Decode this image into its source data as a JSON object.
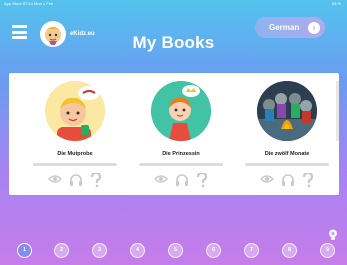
{
  "statusbar": {
    "left": "App Store  07:14  Mon 1 Feb",
    "right": "54 %"
  },
  "header": {
    "logo_text": "eKidz.eu",
    "title": "My Books",
    "language": "German"
  },
  "books": [
    {
      "title": "Die Mutprobe"
    },
    {
      "title": "Die Prinzessin"
    },
    {
      "title": "Die zwölf Monate"
    }
  ],
  "pages": [
    "1",
    "2",
    "3",
    "4",
    "5",
    "6",
    "7",
    "8",
    "9"
  ],
  "active_page": "1",
  "colors": {
    "bg_top": "#53c3ee",
    "bg_bottom": "#c67de9",
    "icon_gray": "#c9c9c9"
  }
}
